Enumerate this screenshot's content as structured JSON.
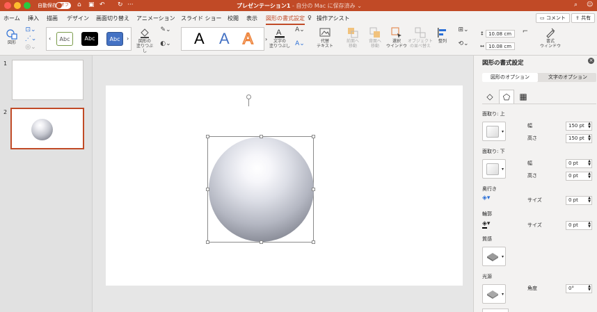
{
  "titlebar": {
    "autosave_label": "自動保存",
    "autosave_state": "オフ",
    "title": "プレゼンテーション1",
    "subtitle": " - 自分の Mac に保存済み ⌄",
    "qa_more": "···"
  },
  "tabs": [
    "ホーム",
    "挿入",
    "描画",
    "デザイン",
    "画面切り替え",
    "アニメーション",
    "スライド ショー",
    "校閲",
    "表示",
    "図形の書式設定",
    "操作アシスト"
  ],
  "active_tab": "図形の書式設定",
  "tab_buttons": {
    "comment": "コメント",
    "share": "共有"
  },
  "ribbon": {
    "shapes_label": "図形",
    "style_presets": [
      "Abc",
      "Abc",
      "Abc"
    ],
    "fill_label": "図形の\n塗りつぶし",
    "wordart": [
      "A",
      "A",
      "A"
    ],
    "text_fill_label": "文字の\n塗りつぶし",
    "alt_text_label": "代替\nテキスト",
    "bring_forward_label": "前面へ\n移動",
    "send_backward_label": "背面へ\n移動",
    "selection_pane_label": "選択\nウインドウ",
    "arrange_objects_label": "オブジェクト\nの並べ替え",
    "align_label": "整列",
    "height_value": "10.08 cm",
    "width_value": "10.08 cm",
    "format_pane_label": "書式\nウィンドウ"
  },
  "slides": [
    {
      "number": "1"
    },
    {
      "number": "2"
    }
  ],
  "pane": {
    "title": "図形の書式設定",
    "tab_shape": "図形のオプション",
    "tab_text": "文字のオプション",
    "bevel_top": "面取り: 上",
    "bevel_bottom": "面取り: 下",
    "width_label": "幅",
    "height_label": "高さ",
    "top_width": "150 pt",
    "top_height": "150 pt",
    "bottom_width": "0 pt",
    "bottom_height": "0 pt",
    "depth_label": "奥行き",
    "contour_label": "輪郭",
    "size_label": "サイズ",
    "depth_size": "0 pt",
    "contour_size": "0 pt",
    "material_label": "質感",
    "lighting_label": "光源",
    "angle_label": "角度",
    "angle_value": "0°"
  },
  "colors": {
    "accent": "#c14a26",
    "ribbon_bg": "#f3f2f1",
    "canvas_bg": "#e6e6e6"
  }
}
